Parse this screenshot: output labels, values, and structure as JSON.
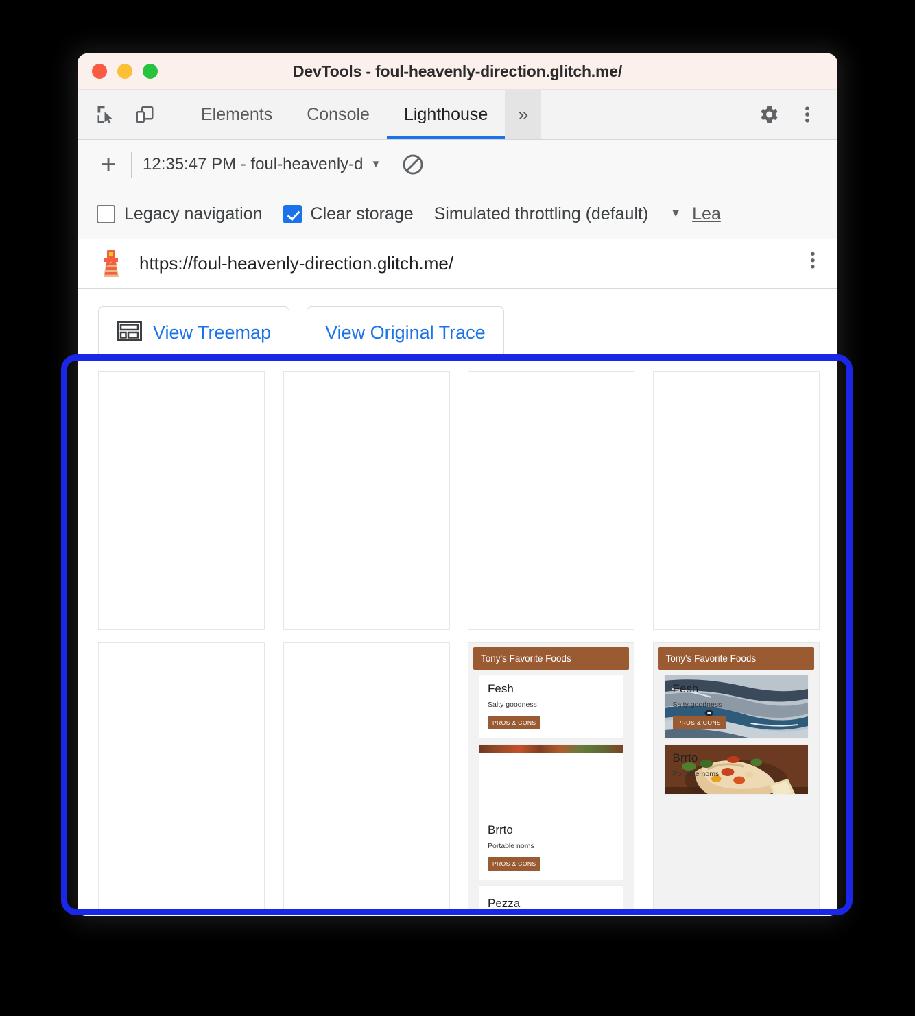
{
  "window": {
    "title": "DevTools - foul-heavenly-direction.glitch.me/",
    "traffic_lights": [
      "close",
      "minimize",
      "maximize"
    ]
  },
  "toolbar": {
    "inspect_icon": "inspect-element-icon",
    "device_icon": "device-toolbar-icon",
    "tabs": [
      {
        "label": "Elements",
        "active": false
      },
      {
        "label": "Console",
        "active": false
      },
      {
        "label": "Lighthouse",
        "active": true
      }
    ],
    "more_tabs_label": "»",
    "settings_icon": "gear-icon",
    "menu_icon": "three-dot-menu-icon"
  },
  "runbar": {
    "new_report_label": "+",
    "report_selected": "12:35:47 PM - foul-heavenly-d",
    "caret": "▼",
    "clear_icon": "no-entry-clear-icon"
  },
  "options": {
    "legacy_navigation": {
      "label": "Legacy navigation",
      "checked": false
    },
    "clear_storage": {
      "label": "Clear storage",
      "checked": true
    },
    "throttling": "Simulated throttling (default)",
    "throttling_caret": "▼",
    "learn_more": "Lea"
  },
  "report": {
    "lighthouse_icon": "lighthouse-icon",
    "url": "https://foul-heavenly-direction.glitch.me/",
    "menu_icon": "three-dot-menu-icon"
  },
  "actions": [
    {
      "label": "View Treemap",
      "icon": "treemap-icon"
    },
    {
      "label": "View Original Trace",
      "icon": "none"
    }
  ],
  "filmstrip": {
    "rows": [
      {
        "frames": [
          {
            "state": "blank"
          },
          {
            "state": "blank"
          },
          {
            "state": "blank"
          },
          {
            "state": "blank"
          }
        ]
      },
      {
        "frames": [
          {
            "state": "blank"
          },
          {
            "state": "blank"
          },
          {
            "state": "text-only"
          },
          {
            "state": "with-images"
          }
        ]
      }
    ]
  },
  "app_preview": {
    "header": "Tony's Favorite Foods",
    "header_color": "#9a5b33",
    "button_color": "#9a5b33",
    "cards": [
      {
        "title": "Fesh",
        "subtitle": "Salty goodness",
        "button": "PROS & CONS",
        "image": "fish-photo"
      },
      {
        "title": "Brrto",
        "subtitle": "Portable noms",
        "button": "PROS & CONS",
        "image": "burrito-photo"
      },
      {
        "title": "Pezza",
        "subtitle": "",
        "button": "",
        "image": "pizza-photo"
      }
    ]
  },
  "highlight": {
    "color": "#1a27e8",
    "target": "filmstrip-region"
  }
}
